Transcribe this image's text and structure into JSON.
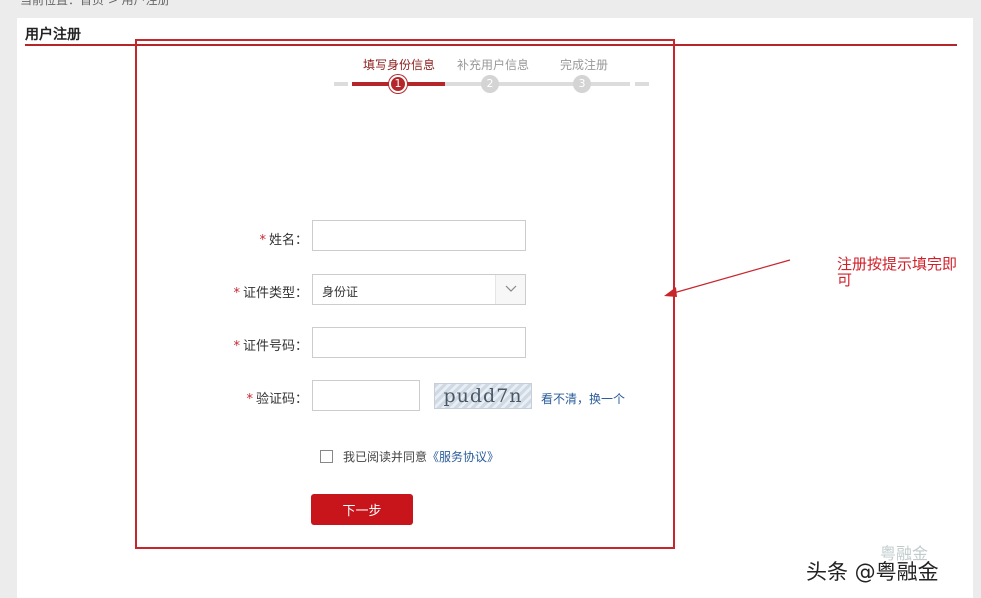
{
  "breadcrumb": "当前位置：首页 > 用户注册",
  "page_title": "用户注册",
  "steps": [
    {
      "label": "填写身份信息",
      "number": "1"
    },
    {
      "label": "补充用户信息",
      "number": "2"
    },
    {
      "label": "完成注册",
      "number": "3"
    }
  ],
  "form": {
    "required_mark": "*",
    "name": {
      "label": "姓名：",
      "value": ""
    },
    "id_type": {
      "label": "证件类型：",
      "value": "身份证"
    },
    "id_number": {
      "label": "证件号码：",
      "value": ""
    },
    "captcha": {
      "label": "验证码：",
      "value": "",
      "image_text": "pudd7n",
      "refresh": "看不清，换一个"
    }
  },
  "agreement": {
    "prefix": "我已阅读并同意",
    "link": "《服务协议》"
  },
  "next_button": "下一步",
  "annotation": "注册按提示填完即可",
  "watermark": "头条 @粤融金",
  "watermark_faded": "粤融金",
  "colors": {
    "accent": "#c8262d",
    "link": "#2a5c9a",
    "button": "#c8141b"
  }
}
